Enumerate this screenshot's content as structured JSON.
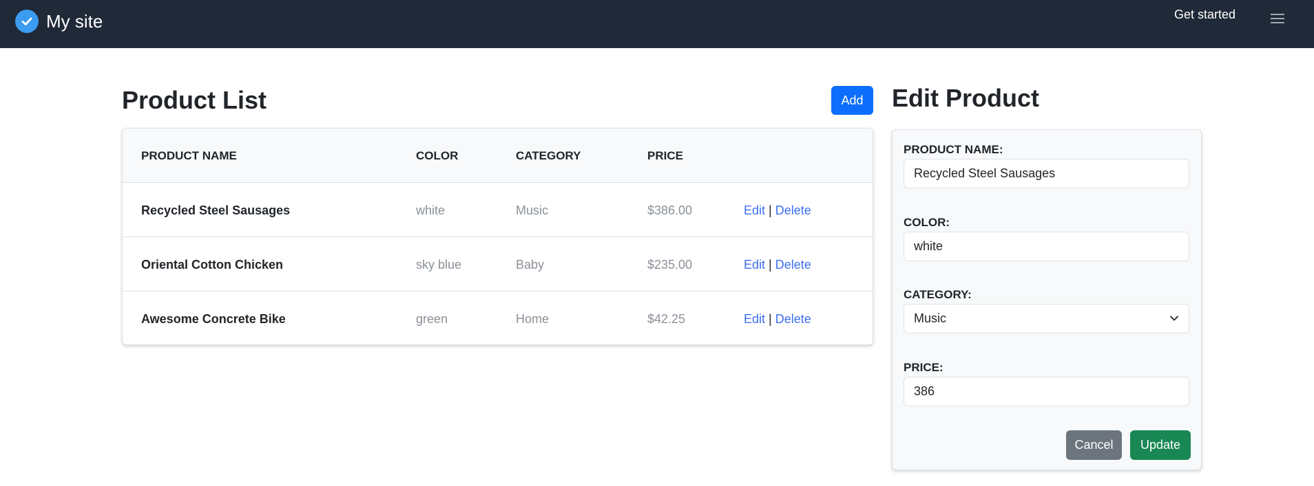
{
  "navbar": {
    "site_name": "My site",
    "logo_icon": "check-circle-icon",
    "get_started": "Get started",
    "menu_icon": "hamburger-menu-icon",
    "background": "#1f2937"
  },
  "product_list": {
    "title": "Product List",
    "add_label": "Add",
    "columns": [
      "PRODUCT NAME",
      "COLOR",
      "CATEGORY",
      "PRICE"
    ],
    "rows": [
      {
        "name": "Recycled Steel Sausages",
        "color": "white",
        "category": "Music",
        "price": "$386.00",
        "edit": "Edit",
        "separator": "|",
        "delete": "Delete"
      },
      {
        "name": "Oriental Cotton Chicken",
        "color": "sky blue",
        "category": "Baby",
        "price": "$235.00",
        "edit": "Edit",
        "separator": "|",
        "delete": "Delete"
      },
      {
        "name": "Awesome Concrete Bike",
        "color": "green",
        "category": "Home",
        "price": "$42.25",
        "edit": "Edit",
        "separator": "|",
        "delete": "Delete"
      }
    ]
  },
  "edit_product": {
    "title": "Edit Product",
    "name_label": "PRODUCT NAME:",
    "name_value": "Recycled Steel Sausages",
    "color_label": "COLOR:",
    "color_value": "white",
    "category_label": "CATEGORY:",
    "category_value": "Music",
    "price_label": "PRICE:",
    "price_value": "386",
    "cancel_label": "Cancel",
    "update_label": "Update"
  },
  "colors": {
    "primary": "#0d6efd",
    "secondary": "#6c757d",
    "success": "#198754",
    "link": "#3d6ef0"
  }
}
